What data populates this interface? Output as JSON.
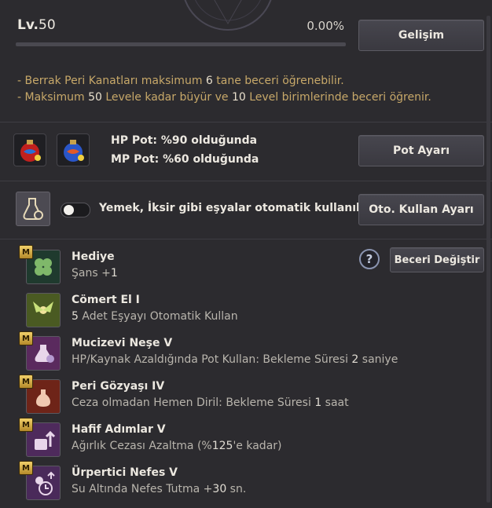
{
  "header": {
    "level_prefix": "Lv.",
    "level_value": "50",
    "percent": "0.00%",
    "progress_fraction": 0,
    "develop_button": "Gelişim"
  },
  "notes": [
    {
      "a": "- Berrak Peri Kanatları maksimum ",
      "n": "6",
      "b": " tane beceri öğrenebilir."
    },
    {
      "a": "- Maksimum ",
      "n": "50",
      "b": " Levele kadar büyür ve ",
      "n2": "10",
      "c": " Level birimlerinde beceri öğrenir."
    }
  ],
  "potions": {
    "hp_label": "HP Pot: %90 olduğunda",
    "mp_label": "MP Pot: %60 olduğunda",
    "button": "Pot Ayarı",
    "hp_icon": "red-potion-icon",
    "mp_icon": "blue-potion-icon"
  },
  "auto_use": {
    "label": "Yemek, İksir gibi eşyalar otomatik kullanılır.",
    "button": "Oto. Kullan Ayarı",
    "toggle_on": false
  },
  "skills_header": {
    "help": "?",
    "change_button": "Beceri Değiştir"
  },
  "skills": [
    {
      "badge": "M",
      "name": "Hediye",
      "desc_a": "Şans +",
      "desc_n": "1",
      "desc_b": "",
      "icon": "clover-icon",
      "color": "#1f3a2e"
    },
    {
      "badge": "",
      "name": "Cömert El I",
      "desc_a": "",
      "desc_n": "5",
      "desc_b": " Adet Eşyayı Otomatik Kullan",
      "icon": "fairy-icon",
      "color": "#4a5a22"
    },
    {
      "badge": "M",
      "name": "Mucizevi Neşe V",
      "desc_a": "HP/Kaynak Azaldığında Pot Kullan: Bekleme Süresi ",
      "desc_n": "2",
      "desc_b": " saniye",
      "icon": "potion-flask-icon",
      "color": "#5a2a5e"
    },
    {
      "badge": "M",
      "name": "Peri Gözyaşı IV",
      "desc_a": "Ceza olmadan Hemen Diril: Bekleme Süresi ",
      "desc_n": "1",
      "desc_b": " saat",
      "icon": "tear-vial-icon",
      "color": "#6e2418"
    },
    {
      "badge": "M",
      "name": "Hafif Adımlar V",
      "desc_a": "Ağırlık Cezası Azaltma (%",
      "desc_n": "125",
      "desc_b": "'e kadar)",
      "icon": "weight-icon",
      "color": "#4e2a5c"
    },
    {
      "badge": "M",
      "name": "Ürpertici Nefes V",
      "desc_a": "Su Altında Nefes Tutma +",
      "desc_n": "30",
      "desc_b": " sn.",
      "icon": "breath-timer-icon",
      "color": "#4a2a5a"
    }
  ]
}
